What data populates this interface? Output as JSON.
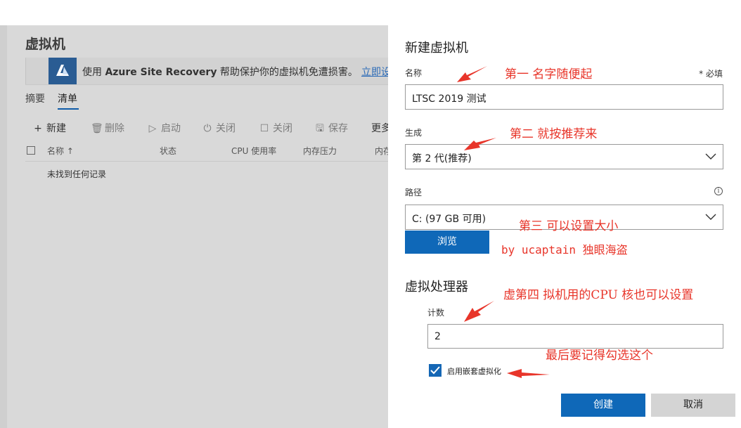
{
  "background": {
    "title": "虚拟机",
    "banner": {
      "prefix": "使用 ",
      "bold": "Azure Site Recovery",
      "suffix": " 帮助保护你的虚拟机免遭损害。",
      "link": "立即设"
    },
    "tabs": [
      "摘要",
      "清单"
    ],
    "toolbar": [
      {
        "icon": "plus-icon",
        "label": "新建"
      },
      {
        "icon": "trash-icon",
        "label": "删除"
      },
      {
        "icon": "play-icon",
        "label": "启动"
      },
      {
        "icon": "power-icon",
        "label": "关闭"
      },
      {
        "icon": "stop-icon",
        "label": "关闭"
      },
      {
        "icon": "save-icon",
        "label": "保存"
      },
      {
        "icon": "",
        "label": "更多"
      }
    ],
    "columns": [
      "名称 ↑",
      "状态",
      "CPU 使用率",
      "内存压力",
      "内存"
    ],
    "empty_text": "未找到任何记录"
  },
  "panel": {
    "title": "新建虚拟机",
    "name_label": "名称",
    "required": "* 必填",
    "name_value": "LTSC 2019 测试",
    "generation_label": "生成",
    "generation_value": "第 2 代(推荐)",
    "path_label": "路径",
    "path_value": "C: (97 GB 可用)",
    "browse": "浏览",
    "processor_title": "虚拟处理器",
    "count_label": "计数",
    "count_value": "2",
    "nested_label": "启用嵌套虚拟化",
    "nested_checked": true,
    "create": "创建",
    "cancel": "取消"
  },
  "annotations": {
    "a1": "第一  名字随便起",
    "a2": "第二  就按推荐来",
    "a3": "第三  可以设置大小",
    "a4": "by ucaptain  独眼海盗",
    "a5": "虚第四  拟机用的CPU 核也可以设置",
    "a6": "最后要记得勾选这个",
    "color": "#e8352a"
  }
}
